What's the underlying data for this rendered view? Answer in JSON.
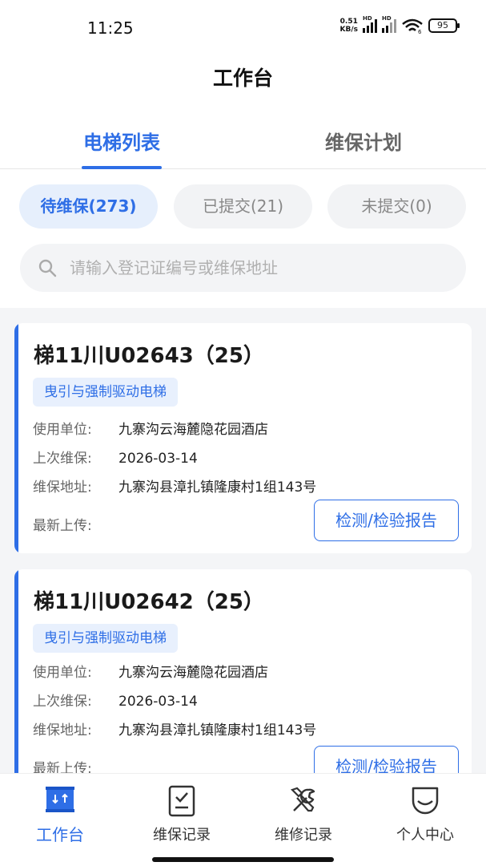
{
  "status_bar": {
    "time": "11:25",
    "net_speed_value": "0.51",
    "net_speed_unit": "KB/s",
    "signal_1_label": "HD",
    "signal_2_label": "HD",
    "wifi_label": "6",
    "battery": "95"
  },
  "header": {
    "title": "工作台"
  },
  "tabs": [
    {
      "label": "电梯列表",
      "active": true
    },
    {
      "label": "维保计划",
      "active": false
    }
  ],
  "filters": [
    {
      "label": "待维保(273)",
      "active": true
    },
    {
      "label": "已提交(21)",
      "active": false
    },
    {
      "label": "未提交(0)",
      "active": false
    }
  ],
  "search": {
    "placeholder": "请输入登记证编号或维保地址"
  },
  "cards": [
    {
      "title": "梯11川U02643（25）",
      "tag": "曳引与强制驱动电梯",
      "user_unit_label": "使用单位:",
      "user_unit": "九寨沟云海麓隐花园酒店",
      "last_maint_label": "上次维保:",
      "last_maint": "2026-03-14",
      "address_label": "维保地址:",
      "address": "九寨沟县漳扎镇隆康村1组143号",
      "latest_upload_label": "最新上传:",
      "report_button": "检测/检验报告"
    },
    {
      "title": "梯11川U02642（25）",
      "tag": "曳引与强制驱动电梯",
      "user_unit_label": "使用单位:",
      "user_unit": "九寨沟云海麓隐花园酒店",
      "last_maint_label": "上次维保:",
      "last_maint": "2026-03-14",
      "address_label": "维保地址:",
      "address": "九寨沟县漳扎镇隆康村1组143号",
      "latest_upload_label": "最新上传:",
      "report_button": "检测/检验报告"
    }
  ],
  "bottom_nav": [
    {
      "label": "工作台",
      "icon": "workbench-icon",
      "active": true
    },
    {
      "label": "维保记录",
      "icon": "clipboard-check-icon",
      "active": false
    },
    {
      "label": "维修记录",
      "icon": "tools-icon",
      "active": false
    },
    {
      "label": "个人中心",
      "icon": "profile-icon",
      "active": false
    }
  ],
  "colors": {
    "accent": "#2e6ee6",
    "chip_active_bg": "#e6effc",
    "list_bg": "#f4f5f7"
  }
}
